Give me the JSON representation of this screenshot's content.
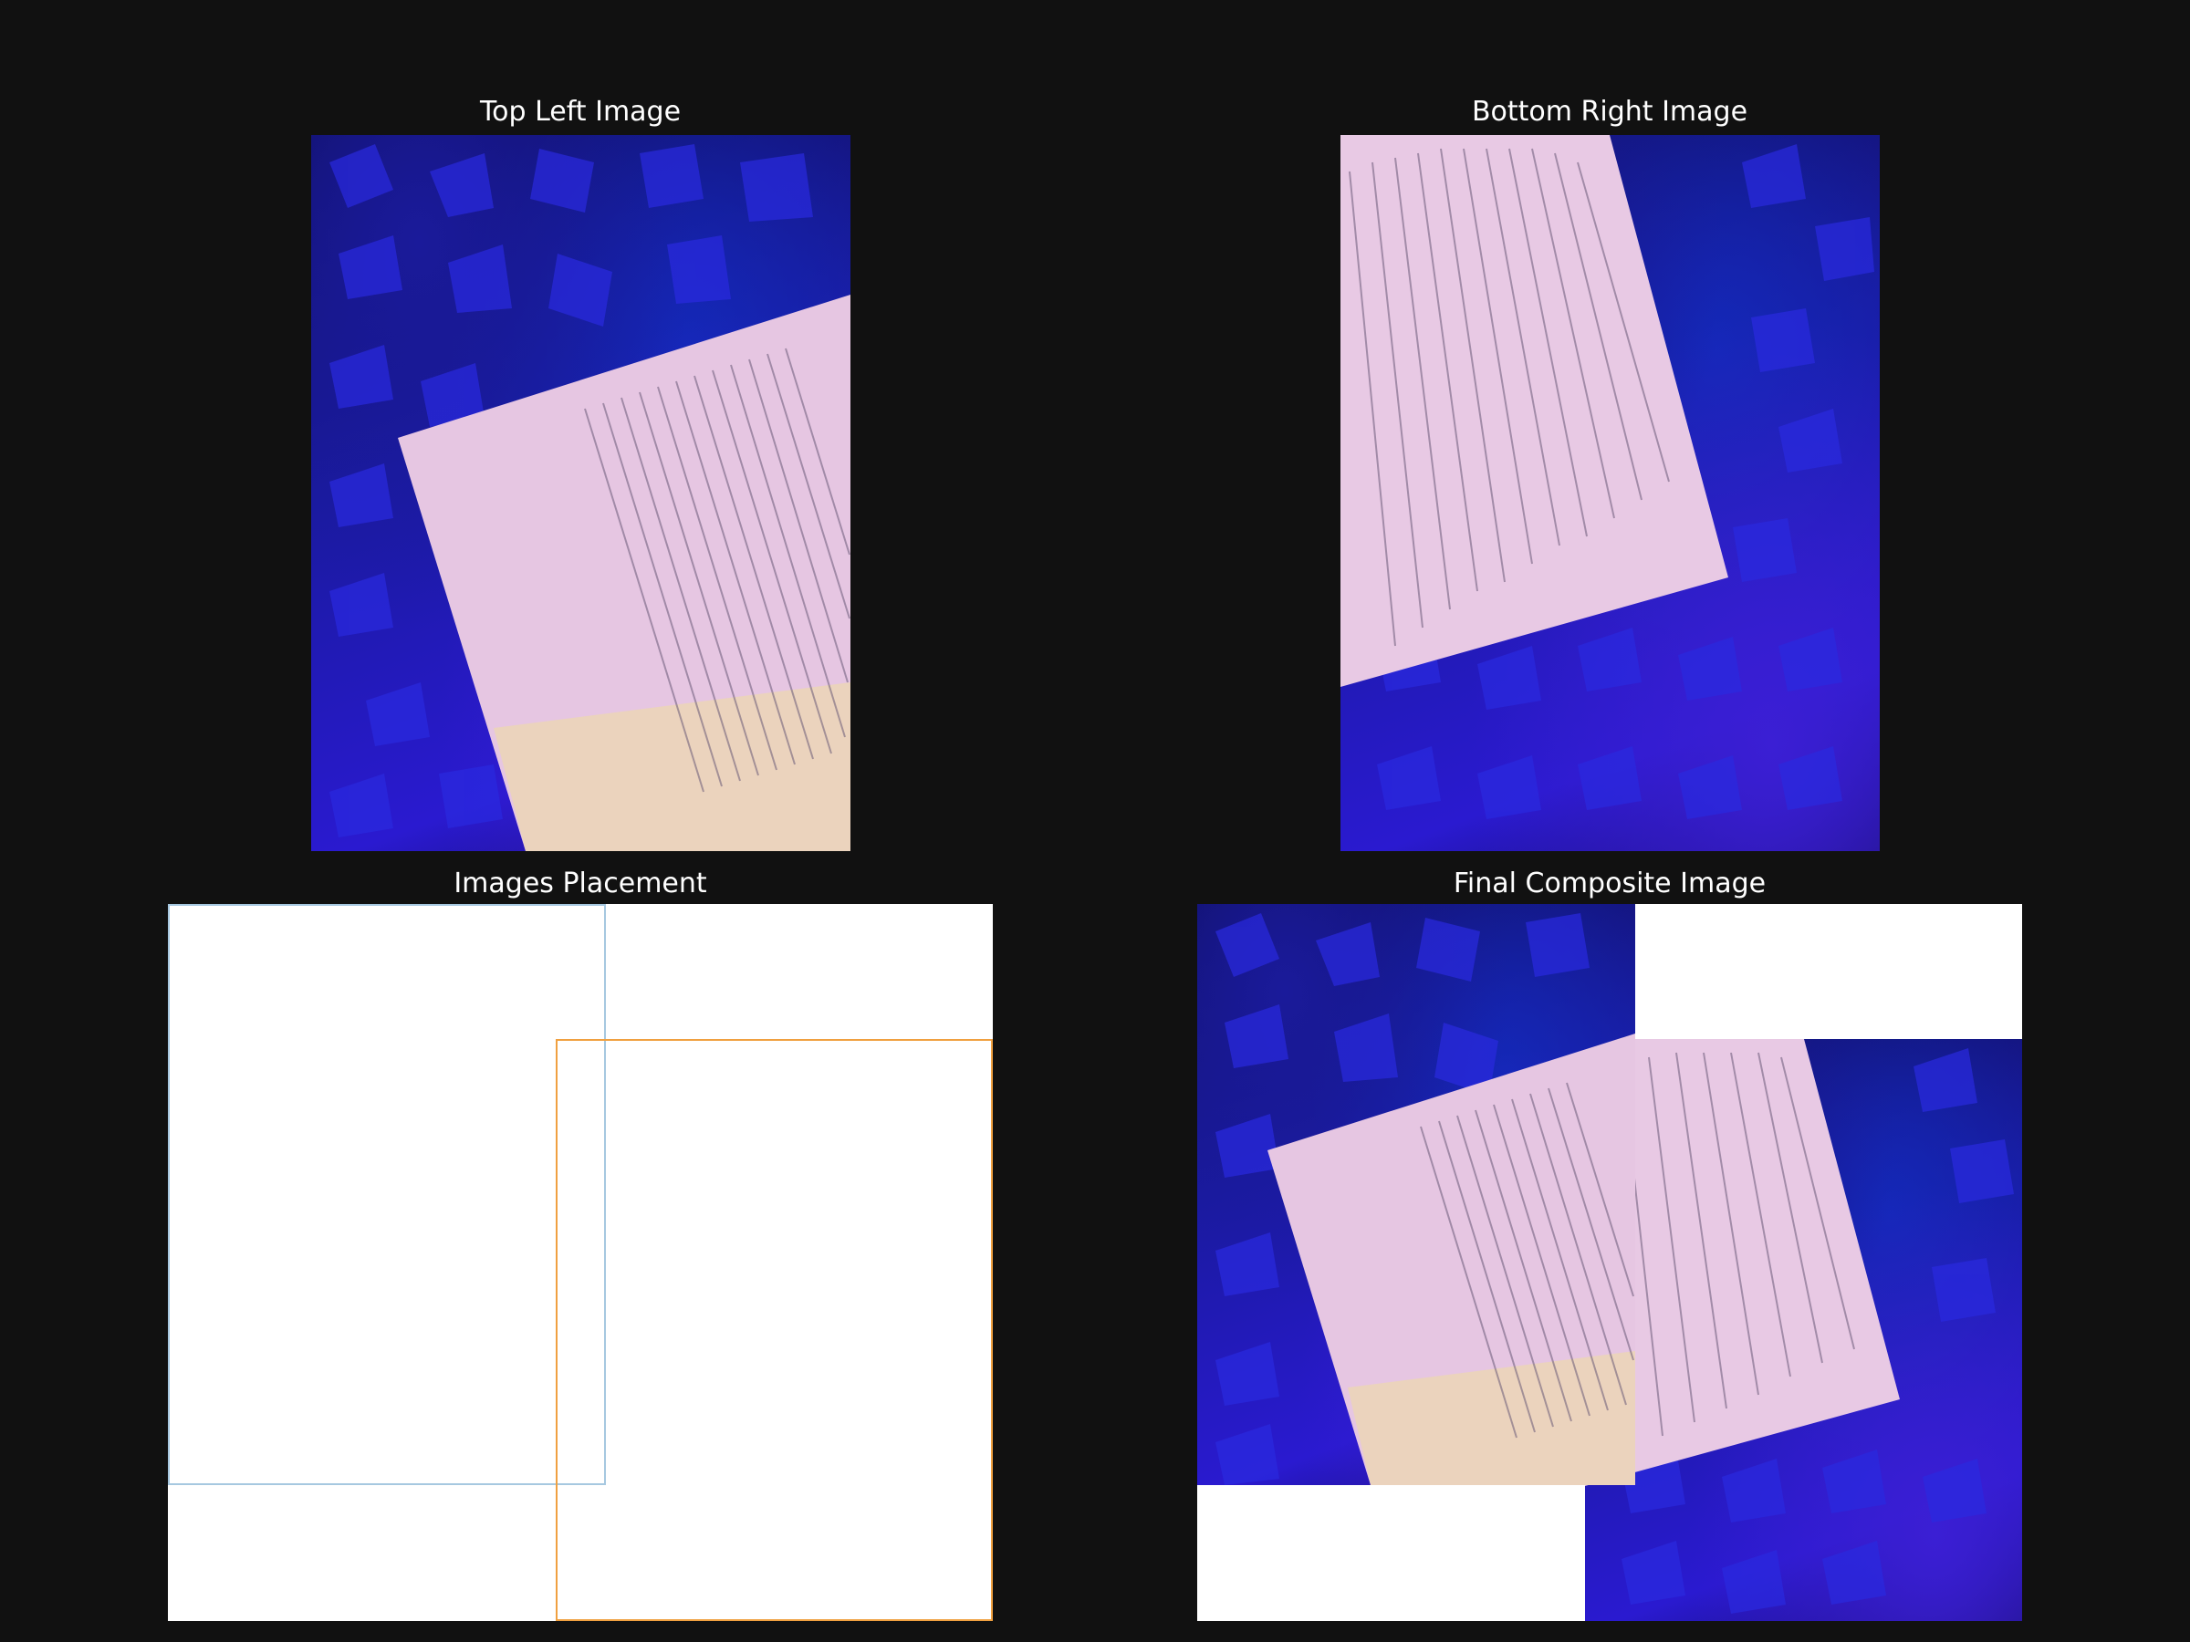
{
  "panels": {
    "top_left": {
      "title": "Top Left Image"
    },
    "bottom_right": {
      "title": "Bottom Right Image"
    },
    "placement": {
      "title": "Images Placement",
      "outline_colors": {
        "top_left": "#a6c8e0",
        "bottom_right": "#f0a040"
      }
    },
    "composite": {
      "title": "Final Composite Image"
    }
  },
  "colors": {
    "background": "#111111",
    "title_text": "#ffffff",
    "paper": "#e8c8e0",
    "canvas": "#ffffff"
  }
}
